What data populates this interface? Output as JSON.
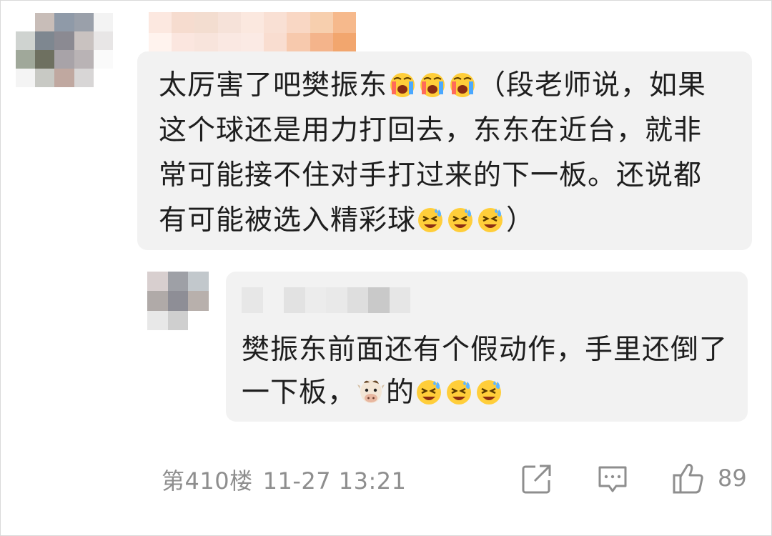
{
  "comment": {
    "text_1": "太厉害了吧樊振东",
    "text_2": "（段老师说，如果这个球还是用力打回去，东东在近台，就非常可能接不住对手打过来的下一板。还说都有可能被选入精彩球",
    "text_3": "）",
    "emoji_group_1": [
      "crying-face",
      "crying-face",
      "crying-face"
    ],
    "emoji_group_2": [
      "laughing-sweat-face",
      "laughing-sweat-face",
      "laughing-sweat-face"
    ]
  },
  "reply": {
    "text_1": "樊振东前面还有个假动作，手里还倒了一下板，",
    "text_2": "的",
    "emoji_cow": "cow-face",
    "emoji_group": [
      "laughing-sweat-face",
      "laughing-sweat-face",
      "laughing-sweat-face"
    ]
  },
  "footer": {
    "floor": "第410楼",
    "timestamp": "11-27 13:21",
    "like_count": "89",
    "icons": [
      "share-icon",
      "comment-icon",
      "thumbs-up-icon"
    ]
  },
  "colors": {
    "bubble_bg": "#f2f2f2",
    "text": "#1e1e1e",
    "meta": "#8e8e8e"
  }
}
